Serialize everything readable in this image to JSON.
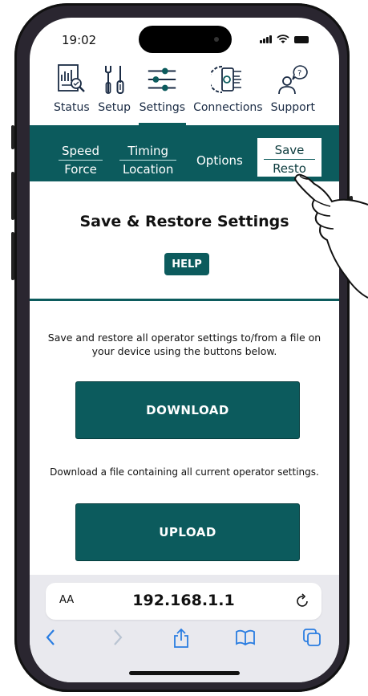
{
  "status_bar": {
    "time": "19:02"
  },
  "top_nav": {
    "items": [
      {
        "label": "Status",
        "icon": "status-icon"
      },
      {
        "label": "Setup",
        "icon": "tools-icon"
      },
      {
        "label": "Settings",
        "icon": "sliders-icon",
        "active": true
      },
      {
        "label": "Connections",
        "icon": "connections-icon"
      },
      {
        "label": "Support",
        "icon": "support-icon"
      }
    ]
  },
  "sub_tabs": [
    {
      "line1": "Speed",
      "line2": "Force"
    },
    {
      "line1": "Timing",
      "line2": "Location"
    },
    {
      "line1": "Options",
      "line2": ""
    },
    {
      "line1": "Save",
      "line2": "Resto",
      "active": true
    }
  ],
  "page": {
    "title": "Save & Restore Settings",
    "help_label": "HELP",
    "description": "Save and restore all operator settings to/from a file on your device using the buttons below.",
    "download_label": "DOWNLOAD",
    "download_note": "Download a file containing all current operator settings.",
    "upload_label": "UPLOAD"
  },
  "browser": {
    "aa_label": "AA",
    "url": "192.168.1.1"
  },
  "colors": {
    "accent": "#0c5b5d"
  }
}
